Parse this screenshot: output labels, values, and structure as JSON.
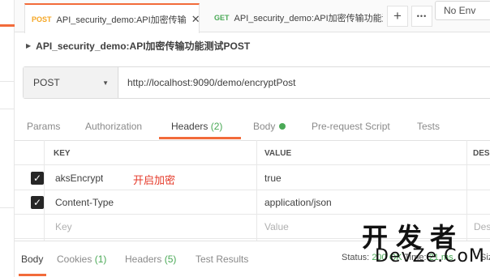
{
  "tabs": [
    {
      "method": "POST",
      "title": "API_security_demo:API加密传输",
      "close": "✕"
    },
    {
      "method": "GET",
      "title": "API_security_demo:API加密传输功能测"
    }
  ],
  "toolbar": {
    "new_tab": "+",
    "more": "•••"
  },
  "environment": {
    "selected": "No Env"
  },
  "request": {
    "name": "API_security_demo:API加密传输功能测试POST",
    "method": "POST",
    "url": "http://localhost:9090/demo/encryptPost"
  },
  "request_tabs": {
    "params": "Params",
    "authorization": "Authorization",
    "headers": "Headers",
    "headers_count": "(2)",
    "body": "Body",
    "pre_request": "Pre-request Script",
    "tests": "Tests"
  },
  "headers_table": {
    "columns": {
      "key": "KEY",
      "value": "VALUE",
      "description": "DESC"
    },
    "rows": [
      {
        "checked": true,
        "key": "aksEncrypt",
        "value": "true",
        "note": "开启加密"
      },
      {
        "checked": true,
        "key": "Content-Type",
        "value": "application/json"
      }
    ],
    "placeholder": {
      "key": "Key",
      "value": "Value",
      "description": "Des"
    }
  },
  "response_tabs": {
    "body": "Body",
    "cookies": "Cookies",
    "cookies_count": "(1)",
    "headers": "Headers",
    "headers_count": "(5)",
    "test_results": "Test Results"
  },
  "status": {
    "label": "Status:",
    "value": "200 OK",
    "time_label": "Time:",
    "time": "21 ms",
    "size_label": "Siz"
  },
  "watermark": {
    "cn": "开发者",
    "en": "DevZe.CoM"
  },
  "colors": {
    "accent": "#f26b3a",
    "success": "#4aa956",
    "post": "#f5a623",
    "note": "#e53a2a"
  }
}
